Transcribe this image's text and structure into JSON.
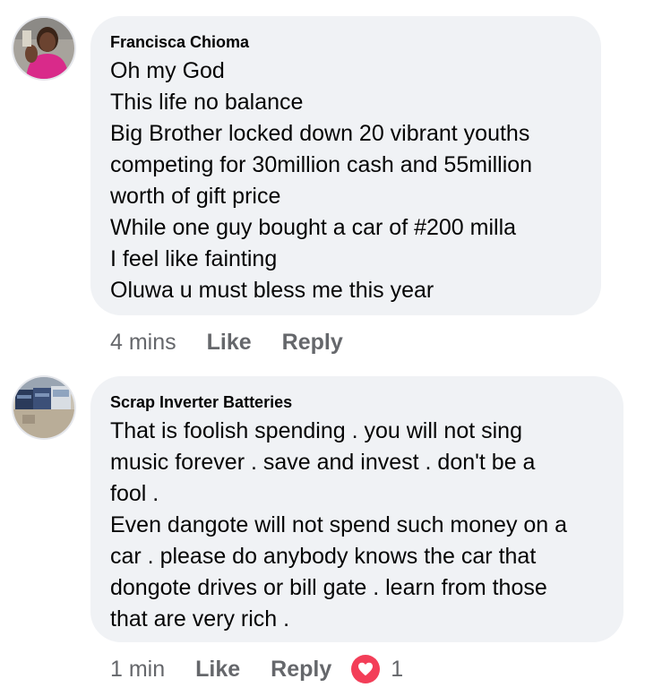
{
  "comments": [
    {
      "author": "Francisca Chioma",
      "lines": [
        "Oh my God",
        "This life no balance",
        "Big Brother locked down 20 vibrant youths",
        "competing for 30million cash and 55million",
        "worth of gift price",
        "While one guy bought a car of #200 milla",
        "I feel like fainting",
        "Oluwa u must bless me this year"
      ],
      "time": "4 mins",
      "like_label": "Like",
      "reply_label": "Reply"
    },
    {
      "author": "Scrap Inverter Batteries",
      "lines": [
        "That is foolish spending . you will not sing",
        "music forever . save and invest . don't be a",
        "fool .",
        "Even dangote will not spend such money on a",
        "car . please do anybody knows the car that",
        "dongote drives or bill gate . learn from those",
        "that are very rich ."
      ],
      "time": "1 min",
      "like_label": "Like",
      "reply_label": "Reply",
      "reaction_icon": "heart-icon",
      "reaction_count": "1"
    }
  ],
  "colors": {
    "bubble": "#f0f2f5",
    "meta_text": "#65676b",
    "heart": "#f33e58"
  }
}
